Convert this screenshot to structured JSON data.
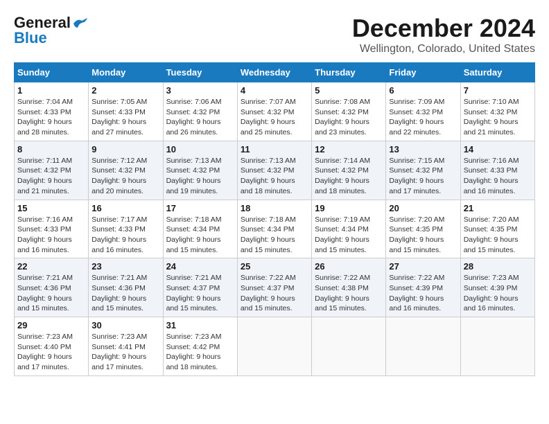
{
  "logo": {
    "general": "General",
    "blue": "Blue"
  },
  "title": "December 2024",
  "location": "Wellington, Colorado, United States",
  "weekdays": [
    "Sunday",
    "Monday",
    "Tuesday",
    "Wednesday",
    "Thursday",
    "Friday",
    "Saturday"
  ],
  "weeks": [
    [
      {
        "day": "1",
        "sunrise": "7:04 AM",
        "sunset": "4:33 PM",
        "daylight": "9 hours and 28 minutes."
      },
      {
        "day": "2",
        "sunrise": "7:05 AM",
        "sunset": "4:33 PM",
        "daylight": "9 hours and 27 minutes."
      },
      {
        "day": "3",
        "sunrise": "7:06 AM",
        "sunset": "4:32 PM",
        "daylight": "9 hours and 26 minutes."
      },
      {
        "day": "4",
        "sunrise": "7:07 AM",
        "sunset": "4:32 PM",
        "daylight": "9 hours and 25 minutes."
      },
      {
        "day": "5",
        "sunrise": "7:08 AM",
        "sunset": "4:32 PM",
        "daylight": "9 hours and 23 minutes."
      },
      {
        "day": "6",
        "sunrise": "7:09 AM",
        "sunset": "4:32 PM",
        "daylight": "9 hours and 22 minutes."
      },
      {
        "day": "7",
        "sunrise": "7:10 AM",
        "sunset": "4:32 PM",
        "daylight": "9 hours and 21 minutes."
      }
    ],
    [
      {
        "day": "8",
        "sunrise": "7:11 AM",
        "sunset": "4:32 PM",
        "daylight": "9 hours and 21 minutes."
      },
      {
        "day": "9",
        "sunrise": "7:12 AM",
        "sunset": "4:32 PM",
        "daylight": "9 hours and 20 minutes."
      },
      {
        "day": "10",
        "sunrise": "7:13 AM",
        "sunset": "4:32 PM",
        "daylight": "9 hours and 19 minutes."
      },
      {
        "day": "11",
        "sunrise": "7:13 AM",
        "sunset": "4:32 PM",
        "daylight": "9 hours and 18 minutes."
      },
      {
        "day": "12",
        "sunrise": "7:14 AM",
        "sunset": "4:32 PM",
        "daylight": "9 hours and 18 minutes."
      },
      {
        "day": "13",
        "sunrise": "7:15 AM",
        "sunset": "4:32 PM",
        "daylight": "9 hours and 17 minutes."
      },
      {
        "day": "14",
        "sunrise": "7:16 AM",
        "sunset": "4:33 PM",
        "daylight": "9 hours and 16 minutes."
      }
    ],
    [
      {
        "day": "15",
        "sunrise": "7:16 AM",
        "sunset": "4:33 PM",
        "daylight": "9 hours and 16 minutes."
      },
      {
        "day": "16",
        "sunrise": "7:17 AM",
        "sunset": "4:33 PM",
        "daylight": "9 hours and 16 minutes."
      },
      {
        "day": "17",
        "sunrise": "7:18 AM",
        "sunset": "4:34 PM",
        "daylight": "9 hours and 15 minutes."
      },
      {
        "day": "18",
        "sunrise": "7:18 AM",
        "sunset": "4:34 PM",
        "daylight": "9 hours and 15 minutes."
      },
      {
        "day": "19",
        "sunrise": "7:19 AM",
        "sunset": "4:34 PM",
        "daylight": "9 hours and 15 minutes."
      },
      {
        "day": "20",
        "sunrise": "7:20 AM",
        "sunset": "4:35 PM",
        "daylight": "9 hours and 15 minutes."
      },
      {
        "day": "21",
        "sunrise": "7:20 AM",
        "sunset": "4:35 PM",
        "daylight": "9 hours and 15 minutes."
      }
    ],
    [
      {
        "day": "22",
        "sunrise": "7:21 AM",
        "sunset": "4:36 PM",
        "daylight": "9 hours and 15 minutes."
      },
      {
        "day": "23",
        "sunrise": "7:21 AM",
        "sunset": "4:36 PM",
        "daylight": "9 hours and 15 minutes."
      },
      {
        "day": "24",
        "sunrise": "7:21 AM",
        "sunset": "4:37 PM",
        "daylight": "9 hours and 15 minutes."
      },
      {
        "day": "25",
        "sunrise": "7:22 AM",
        "sunset": "4:37 PM",
        "daylight": "9 hours and 15 minutes."
      },
      {
        "day": "26",
        "sunrise": "7:22 AM",
        "sunset": "4:38 PM",
        "daylight": "9 hours and 15 minutes."
      },
      {
        "day": "27",
        "sunrise": "7:22 AM",
        "sunset": "4:39 PM",
        "daylight": "9 hours and 16 minutes."
      },
      {
        "day": "28",
        "sunrise": "7:23 AM",
        "sunset": "4:39 PM",
        "daylight": "9 hours and 16 minutes."
      }
    ],
    [
      {
        "day": "29",
        "sunrise": "7:23 AM",
        "sunset": "4:40 PM",
        "daylight": "9 hours and 17 minutes."
      },
      {
        "day": "30",
        "sunrise": "7:23 AM",
        "sunset": "4:41 PM",
        "daylight": "9 hours and 17 minutes."
      },
      {
        "day": "31",
        "sunrise": "7:23 AM",
        "sunset": "4:42 PM",
        "daylight": "9 hours and 18 minutes."
      },
      null,
      null,
      null,
      null
    ]
  ]
}
